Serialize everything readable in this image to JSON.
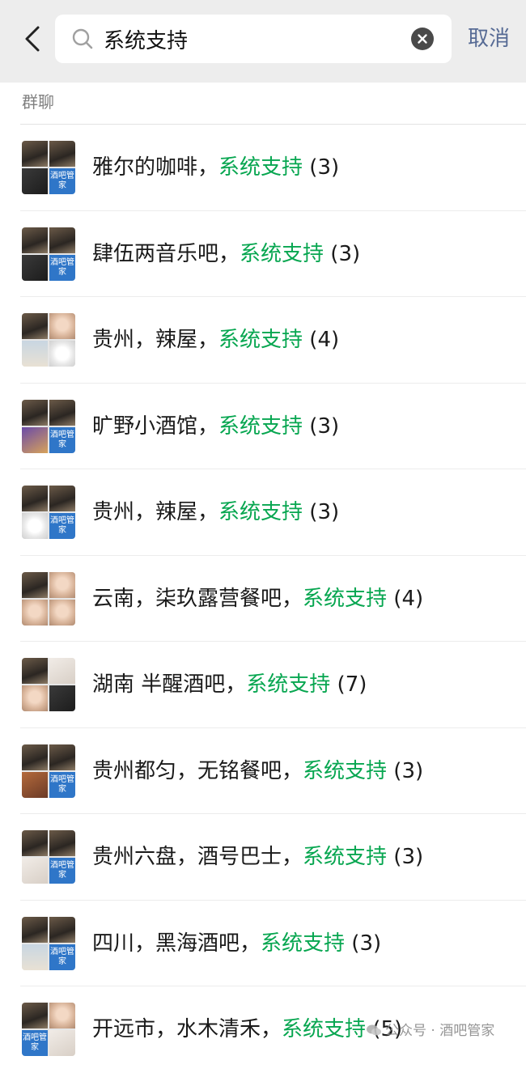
{
  "search": {
    "value": "系统支持",
    "cancel_label": "取消"
  },
  "section": {
    "title": "群聊"
  },
  "results": [
    {
      "name": "雅尔的咖啡，",
      "keyword": "系统支持",
      "count": "(3)",
      "avatar": [
        "t-photo",
        "t-photo",
        "t-dark",
        "t-blue"
      ]
    },
    {
      "name": "肆伍两音乐吧，",
      "keyword": "系统支持",
      "count": "(3)",
      "avatar": [
        "t-photo",
        "t-photo",
        "t-dark",
        "t-blue"
      ]
    },
    {
      "name": "贵州，辣屋，",
      "keyword": "系统支持",
      "count": "(4)",
      "avatar": [
        "t-photo",
        "t-face",
        "t-sky",
        "t-cartoon"
      ]
    },
    {
      "name": "旷野小酒馆，",
      "keyword": "系统支持",
      "count": "(3)",
      "avatar": [
        "t-photo",
        "t-photo",
        "t-purple",
        "t-blue"
      ]
    },
    {
      "name": "贵州，辣屋，",
      "keyword": "系统支持",
      "count": "(3)",
      "avatar": [
        "t-photo",
        "t-photo",
        "t-cartoon",
        "t-blue"
      ]
    },
    {
      "name": "云南，柒玖露营餐吧，",
      "keyword": "系统支持",
      "count": "(4)",
      "avatar": [
        "t-photo",
        "t-face",
        "t-face",
        "t-face"
      ]
    },
    {
      "name": "湖南 半醒酒吧，",
      "keyword": "系统支持",
      "count": "(7)",
      "avatar": [
        "t-photo",
        "t-light",
        "t-face",
        "t-dark"
      ]
    },
    {
      "name": "贵州都匀，无铭餐吧，",
      "keyword": "系统支持",
      "count": "(3)",
      "avatar": [
        "t-photo",
        "t-photo",
        "t-warm",
        "t-blue"
      ]
    },
    {
      "name": "贵州六盘，酒号巴士，",
      "keyword": "系统支持",
      "count": "(3)",
      "avatar": [
        "t-photo",
        "t-photo",
        "t-light",
        "t-blue"
      ]
    },
    {
      "name": "四川，黑海酒吧，",
      "keyword": "系统支持",
      "count": "(3)",
      "avatar": [
        "t-photo",
        "t-photo",
        "t-sky",
        "t-blue"
      ]
    },
    {
      "name": "开远市，水木清禾，",
      "keyword": "系统支持",
      "count": "(5)",
      "avatar": [
        "t-photo",
        "t-face",
        "t-blue",
        "t-light"
      ]
    }
  ],
  "avatar_badge": "酒吧管家",
  "watermark": {
    "text": "公众号 · 酒吧管家"
  },
  "colors": {
    "keyword": "#07a650",
    "cancel": "#576b95",
    "topbar": "#ededed"
  },
  "icons": {
    "back": "chevron-left-icon",
    "search": "search-icon",
    "clear": "clear-icon"
  }
}
